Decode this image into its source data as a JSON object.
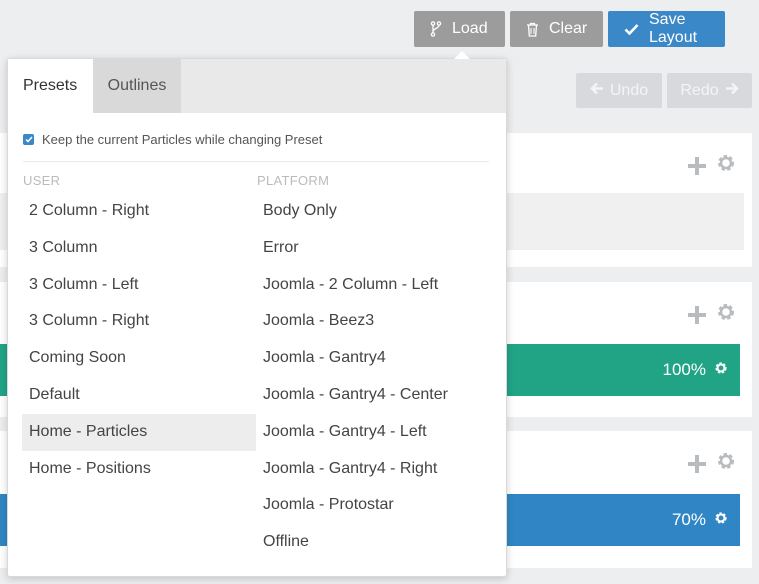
{
  "toolbar": {
    "load_label": "Load",
    "clear_label": "Clear",
    "save_label": "Save Layout",
    "undo_label": "Undo",
    "redo_label": "Redo"
  },
  "sections": [
    {
      "percent": ""
    },
    {
      "percent": "100%"
    },
    {
      "percent": "70%"
    }
  ],
  "popover": {
    "tabs": [
      {
        "label": "Presets",
        "active": true
      },
      {
        "label": "Outlines",
        "active": false
      }
    ],
    "keep_particles": {
      "label": "Keep the current Particles while changing Preset",
      "checked": true
    },
    "user": {
      "heading": "USER",
      "items": [
        "2 Column - Right",
        "3 Column",
        "3 Column - Left",
        "3 Column - Right",
        "Coming Soon",
        "Default",
        "Home - Particles",
        "Home - Positions"
      ]
    },
    "platform": {
      "heading": "PLATFORM",
      "items": [
        "Body Only",
        "Error",
        "Joomla - 2 Column - Left",
        "Joomla - Beez3",
        "Joomla - Gantry4",
        "Joomla - Gantry4 - Center",
        "Joomla - Gantry4 - Left",
        "Joomla - Gantry4 - Right",
        "Joomla - Protostar",
        "Offline"
      ]
    }
  },
  "colors": {
    "accent": "#3b88c9",
    "teal": "#21a486",
    "blue": "#3086c4",
    "button_grey": "#9c9c9c"
  },
  "icons": {
    "load": "fork-icon",
    "clear": "trash-icon",
    "save": "check-icon",
    "undo": "arrow-left-icon",
    "redo": "arrow-right-icon",
    "add": "plus-icon",
    "settings": "gear-icon"
  }
}
